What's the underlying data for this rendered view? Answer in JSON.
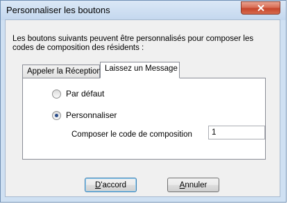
{
  "window": {
    "title": "Personnaliser les boutons",
    "close_icon": "close-icon"
  },
  "description": {
    "line1": "Les boutons suivants peuvent être personnalisés pour composer les",
    "line2": "codes de composition des résidents :"
  },
  "tabs": [
    {
      "label": "Appeler la Réception",
      "active": false
    },
    {
      "label": "Laissez un Message",
      "active": true
    }
  ],
  "options": {
    "default_label": "Par défaut",
    "default_checked": false,
    "custom_label": "Personnaliser",
    "custom_checked": true
  },
  "code": {
    "label": "Composer le code de composition",
    "value": "1"
  },
  "buttons": {
    "ok": {
      "accel": "D",
      "rest": "'accord"
    },
    "cancel": {
      "accel": "A",
      "rest": "nnuler"
    }
  },
  "colors": {
    "close_button": "#c6462c",
    "frame": "#cfe0f2"
  }
}
